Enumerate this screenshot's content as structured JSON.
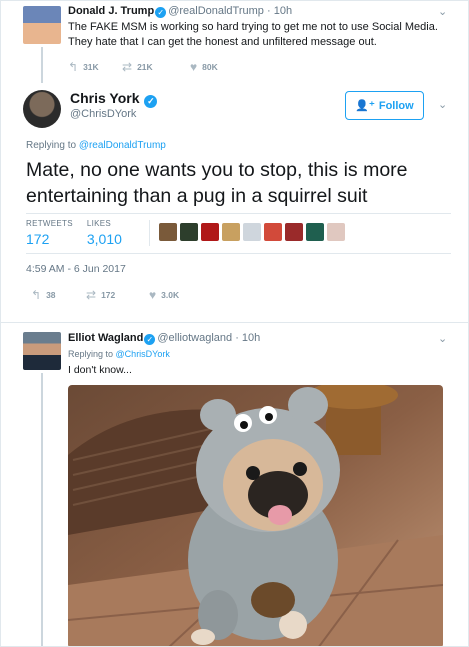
{
  "tweet1": {
    "name": "Donald J. Trump",
    "handle": "@realDonaldTrump",
    "time": "· 10h",
    "text": "The FAKE MSM is working so hard trying to get me not to use Social Media. They hate that I can get the honest and unfiltered message out.",
    "replies": "31K",
    "retweets": "21K",
    "likes": "80K"
  },
  "tweet2": {
    "name": "Chris York",
    "handle": "@ChrisDYork",
    "follow_label": "Follow",
    "replying_prefix": "Replying to",
    "replying_to": "@realDonaldTrump",
    "text": "Mate, no one wants you to stop, this is more entertaining than a pug in a squirrel suit",
    "retweets_label": "RETWEETS",
    "retweets_count": "172",
    "likes_label": "LIKES",
    "likes_count": "3,010",
    "datetime": "4:59 AM - 6 Jun 2017",
    "action_replies": "38",
    "action_retweets": "172",
    "action_likes": "3.0K"
  },
  "tweet3": {
    "name": "Elliot Wagland",
    "handle": "@elliotwagland",
    "time": "· 10h",
    "replying_prefix": "Replying to",
    "replying_to": "@ChrisDYork",
    "text": "I don't know..."
  },
  "colors": {
    "accent": "#1da1f2",
    "muted": "#657786",
    "border": "#e1e8ed"
  },
  "icons": [
    "verified-icon",
    "reply-icon",
    "retweet-icon",
    "like-icon",
    "chevron-down-icon",
    "add-user-icon"
  ]
}
